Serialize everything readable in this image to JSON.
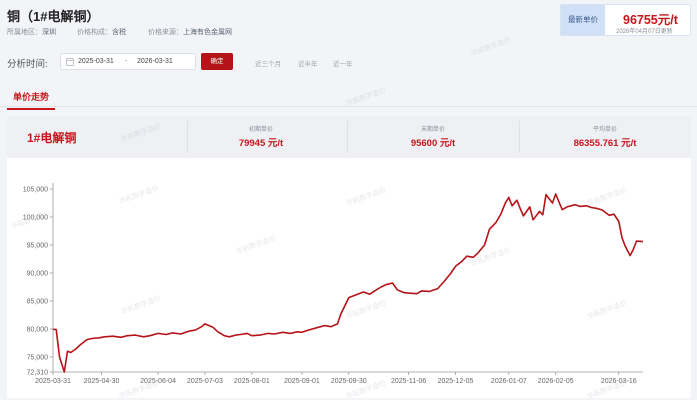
{
  "header": {
    "title": "铜（1#电解铜）",
    "region_label": "所属地区：",
    "region": "深圳",
    "composition_label": "价格构成：",
    "composition": "含税",
    "source_label": "价格来源：",
    "source": "上海有色金属网"
  },
  "latest": {
    "tag": "最新单价",
    "value": "96755元/t",
    "updated": "2026年04月07日更新"
  },
  "filter": {
    "label": "分析时间:",
    "start": "2025-03-31",
    "separator": "-",
    "end": "2026-03-31",
    "confirm": "确定",
    "quick": [
      "近三个月",
      "近半年",
      "近一年"
    ]
  },
  "tabs": [
    {
      "label": "单价走势"
    }
  ],
  "stats": {
    "name": "1#电解铜",
    "items": [
      {
        "label": "初期单价",
        "value": "79945 元/t"
      },
      {
        "label": "末期单价",
        "value": "95600 元/t"
      },
      {
        "label": "平均单价",
        "value": "86355.761 元/t"
      }
    ]
  },
  "watermark": "华拓数字造价",
  "colors": {
    "accent": "#c8151b",
    "line": "#b51318",
    "axis": "#999999"
  },
  "chart_data": {
    "type": "line",
    "title": "",
    "xlabel": "",
    "ylabel": "",
    "grid": false,
    "ylim": [
      72310,
      105000
    ],
    "yticks": [
      105000,
      100000,
      95000,
      90000,
      85000,
      80000,
      75000,
      72310
    ],
    "ytick_labels": [
      "105,000",
      "100,000",
      "95,000",
      "90,000",
      "85,000",
      "80,000",
      "75,000",
      "72,310"
    ],
    "xlim": [
      "2025-03-31",
      "2026-03-31"
    ],
    "xtick_labels": [
      "2025-03-31",
      "2025-04-30",
      "2025-06-04",
      "2025-07-03",
      "2025-08-01",
      "2025-09-01",
      "2025-09-30",
      "2025-11-06",
      "2025-12-05",
      "2026-01-07",
      "2026-02-05",
      "2026-03-16"
    ],
    "series": [
      {
        "x": [
          "2025-03-31",
          "2025-04-02",
          "2025-04-04",
          "2025-04-07",
          "2025-04-09",
          "2025-04-11",
          "2025-04-14",
          "2025-04-17",
          "2025-04-21",
          "2025-04-24",
          "2025-04-28",
          "2025-05-02",
          "2025-05-07",
          "2025-05-12",
          "2025-05-16",
          "2025-05-21",
          "2025-05-26",
          "2025-05-30",
          "2025-06-04",
          "2025-06-09",
          "2025-06-13",
          "2025-06-18",
          "2025-06-23",
          "2025-06-27",
          "2025-07-01",
          "2025-07-03",
          "2025-07-08",
          "2025-07-11",
          "2025-07-15",
          "2025-07-18",
          "2025-07-22",
          "2025-07-25",
          "2025-07-29",
          "2025-08-01",
          "2025-08-06",
          "2025-08-11",
          "2025-08-15",
          "2025-08-20",
          "2025-08-25",
          "2025-08-29",
          "2025-09-01",
          "2025-09-05",
          "2025-09-10",
          "2025-09-15",
          "2025-09-19",
          "2025-09-23",
          "2025-09-25",
          "2025-09-30",
          "2025-10-09",
          "2025-10-13",
          "2025-10-16",
          "2025-10-20",
          "2025-10-23",
          "2025-10-27",
          "2025-10-30",
          "2025-11-03",
          "2025-11-06",
          "2025-11-11",
          "2025-11-14",
          "2025-11-19",
          "2025-11-24",
          "2025-11-28",
          "2025-12-02",
          "2025-12-05",
          "2025-12-09",
          "2025-12-12",
          "2025-12-16",
          "2025-12-19",
          "2025-12-23",
          "2025-12-26",
          "2025-12-30",
          "2026-01-02",
          "2026-01-05",
          "2026-01-07",
          "2026-01-09",
          "2026-01-12",
          "2026-01-14",
          "2026-01-16",
          "2026-01-20",
          "2026-01-22",
          "2026-01-26",
          "2026-01-28",
          "2026-01-30",
          "2026-02-03",
          "2026-02-05",
          "2026-02-09",
          "2026-02-12",
          "2026-02-17",
          "2026-02-20",
          "2026-02-24",
          "2026-02-27",
          "2026-03-03",
          "2026-03-06",
          "2026-03-10",
          "2026-03-13",
          "2026-03-16",
          "2026-03-18",
          "2026-03-20",
          "2026-03-23",
          "2026-03-25",
          "2026-03-27",
          "2026-03-31"
        ],
        "values": [
          79945,
          79900,
          75000,
          72310,
          76000,
          75800,
          76400,
          77200,
          78100,
          78300,
          78400,
          78600,
          78700,
          78500,
          78800,
          78900,
          78600,
          78800,
          79200,
          79000,
          79300,
          79100,
          79600,
          79800,
          80400,
          80900,
          80300,
          79500,
          78800,
          78600,
          78900,
          79000,
          79200,
          78800,
          78900,
          79200,
          79100,
          79400,
          79200,
          79500,
          79400,
          79800,
          80200,
          80600,
          80400,
          80900,
          82600,
          85600,
          86600,
          86200,
          86800,
          87500,
          87900,
          88200,
          87000,
          86500,
          86400,
          86300,
          86800,
          86700,
          87200,
          88500,
          89900,
          91200,
          92100,
          93000,
          92800,
          93600,
          95000,
          97800,
          99000,
          100500,
          102600,
          103500,
          102000,
          103000,
          101500,
          100200,
          101800,
          99500,
          101000,
          100400,
          104000,
          102500,
          104100,
          101300,
          101800,
          102200,
          101900,
          102000,
          101700,
          101500,
          101200,
          100300,
          100500,
          99200,
          96300,
          94800,
          93100,
          94200,
          95700,
          95600
        ]
      }
    ]
  }
}
